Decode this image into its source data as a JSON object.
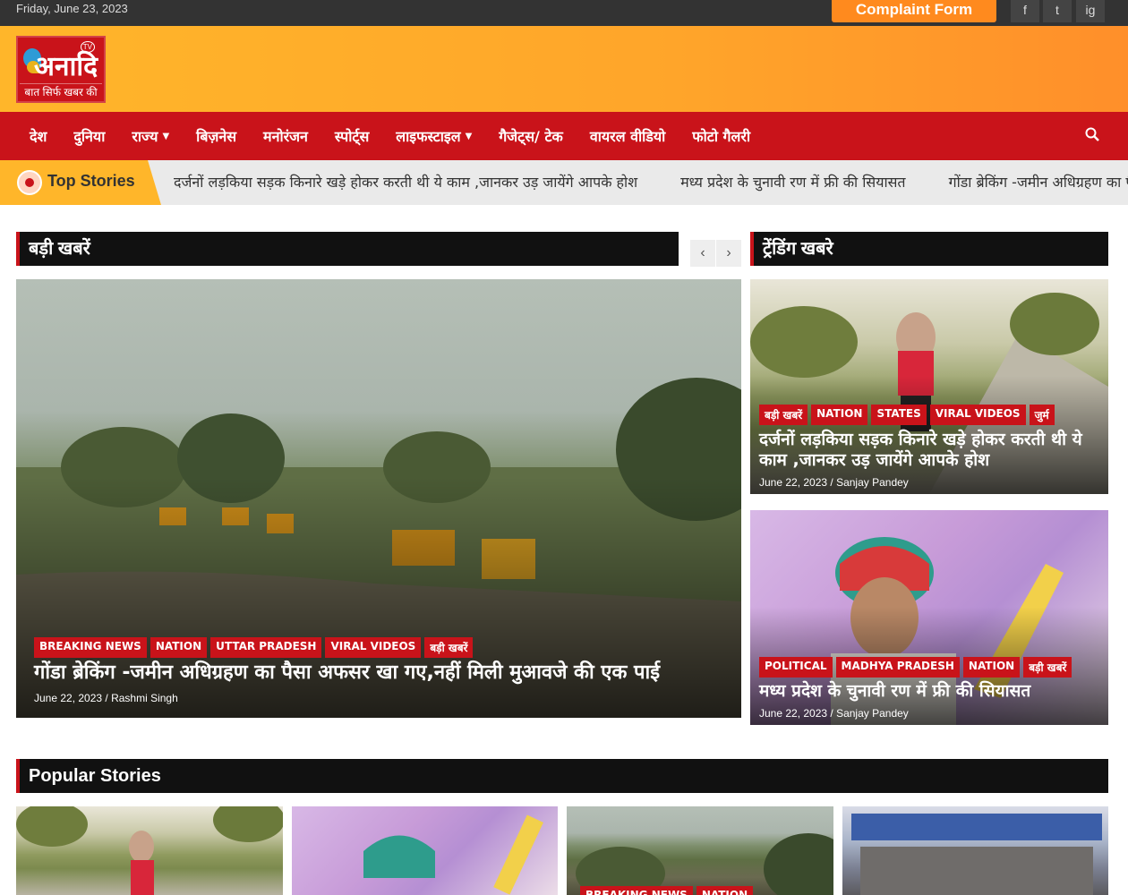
{
  "topbar": {
    "date": "Friday, June 23, 2023",
    "complaint_label": "Complaint Form",
    "social": [
      "f",
      "t",
      "ig"
    ]
  },
  "logo": {
    "name": "अनादि",
    "tagline": "बात सिर्फ खबर की",
    "badge": "TV"
  },
  "nav": {
    "items": [
      {
        "label": "देश",
        "caret": false
      },
      {
        "label": "दुनिया",
        "caret": false
      },
      {
        "label": "राज्य",
        "caret": true
      },
      {
        "label": "बिज़नेस",
        "caret": false
      },
      {
        "label": "मनोरंजन",
        "caret": false
      },
      {
        "label": "स्पोर्ट्स",
        "caret": false
      },
      {
        "label": "लाइफस्टाइल",
        "caret": true
      },
      {
        "label": "गैजेट्स/ टेक",
        "caret": false
      },
      {
        "label": "वायरल वीडियो",
        "caret": false
      },
      {
        "label": "फोटो गैलरी",
        "caret": false
      }
    ]
  },
  "ticker": {
    "label": "Top Stories",
    "items": [
      "दर्जनों लड़किया सड़क किनारे खड़े होकर करती थी ये काम ,जानकर उड़ जायेंगे आपके होश",
      "मध्य प्रदेश के चुनावी रण में फ्री की सियासत",
      "गोंडा ब्रेकिंग -जमीन अधिग्रहण का पैसा अफसर खा गए,नहीं मिली मुआवजे की एक पाई"
    ]
  },
  "big_news": {
    "heading": "बड़ी खबरें",
    "prev": "‹",
    "next": "›",
    "feature": {
      "categories": [
        "BREAKING NEWS",
        "NATION",
        "UTTAR PRADESH",
        "VIRAL VIDEOS",
        "बड़ी खबरें"
      ],
      "title": "गोंडा ब्रेकिंग -जमीन अधिग्रहण का पैसा अफसर खा गए,नहीं मिली मुआवजे की एक पाई",
      "meta": "June 22, 2023 / Rashmi Singh"
    }
  },
  "trending": {
    "heading": "ट्रेंडिंग खबरे",
    "cards": [
      {
        "categories": [
          "बड़ी खबरें",
          "NATION",
          "STATES",
          "VIRAL VIDEOS",
          "जुर्म"
        ],
        "title": "दर्जनों लड़किया सड़क किनारे खड़े होकर करती थी ये काम ,जानकर उड़ जायेंगे आपके होश",
        "meta": "June 22, 2023 / Sanjay Pandey"
      },
      {
        "categories": [
          "POLITICAL",
          "MADHYA PRADESH",
          "NATION",
          "बड़ी खबरें"
        ],
        "title": "मध्य प्रदेश के चुनावी रण में फ्री की सियासत",
        "meta": "June 22, 2023 / Sanjay Pandey"
      }
    ]
  },
  "popular": {
    "heading": "Popular Stories",
    "cards": [
      {
        "categories": []
      },
      {
        "categories": []
      },
      {
        "categories": [
          "BREAKING NEWS",
          "NATION"
        ]
      },
      {
        "categories": []
      }
    ]
  },
  "colors": {
    "brand_red": "#c9131a",
    "accent_orange": "#ffb62a",
    "dark": "#111111"
  }
}
